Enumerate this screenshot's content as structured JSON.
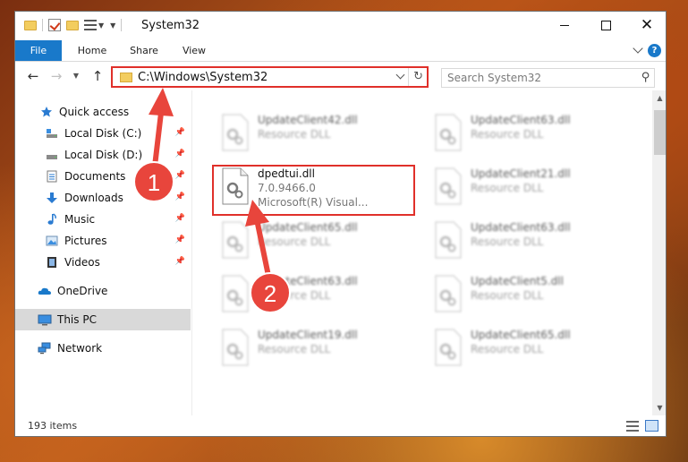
{
  "window": {
    "title": "System32",
    "controls": {
      "minimize": "minimize",
      "maximize": "maximize",
      "close": "✕"
    }
  },
  "ribbon": {
    "tabs": [
      "File",
      "Home",
      "Share",
      "View"
    ],
    "help": "?"
  },
  "nav": {
    "address": "C:\\Windows\\System32",
    "search_placeholder": "Search System32"
  },
  "sidebar": {
    "items": [
      {
        "label": "Quick access",
        "icon": "star-icon",
        "pinned": false
      },
      {
        "label": "Local Disk (C:)",
        "icon": "drive-icon",
        "pinned": true
      },
      {
        "label": "Local Disk (D:)",
        "icon": "drive-icon",
        "pinned": true
      },
      {
        "label": "Documents",
        "icon": "documents-icon",
        "pinned": true
      },
      {
        "label": "Downloads",
        "icon": "downloads-icon",
        "pinned": true
      },
      {
        "label": "Music",
        "icon": "music-icon",
        "pinned": true
      },
      {
        "label": "Pictures",
        "icon": "pictures-icon",
        "pinned": true
      },
      {
        "label": "Videos",
        "icon": "videos-icon",
        "pinned": true
      },
      {
        "label": "OneDrive",
        "icon": "onedrive-icon",
        "pinned": false
      },
      {
        "label": "This PC",
        "icon": "this-pc-icon",
        "pinned": false,
        "selected": true
      },
      {
        "label": "Network",
        "icon": "network-icon",
        "pinned": false
      }
    ]
  },
  "files": [
    {
      "name": "UpdateClient42.dll",
      "type": "Resource DLL",
      "dimmed": true
    },
    {
      "name": "UpdateClient63.dll",
      "type": "Resource DLL",
      "dimmed": true
    },
    {
      "name": "dpedtui.dll",
      "version": "7.0.9466.0",
      "type": "Microsoft(R) Visual...",
      "dimmed": false,
      "highlighted": true
    },
    {
      "name": "UpdateClient21.dll",
      "type": "Resource DLL",
      "dimmed": true
    },
    {
      "name": "UpdateClient65.dll",
      "type": "Resource DLL",
      "dimmed": true
    },
    {
      "name": "UpdateClient63.dll",
      "type": "Resource DLL",
      "dimmed": true
    },
    {
      "name": "UpdateClient63.dll",
      "type": "Resource DLL",
      "dimmed": true
    },
    {
      "name": "UpdateClient5.dll",
      "type": "Resource DLL",
      "dimmed": true
    },
    {
      "name": "UpdateClient19.dll",
      "type": "Resource DLL",
      "dimmed": true
    },
    {
      "name": "UpdateClient65.dll",
      "type": "Resource DLL",
      "dimmed": true
    }
  ],
  "status": {
    "item_count": "193 items"
  },
  "annotations": {
    "step1": "1",
    "step2": "2"
  },
  "colors": {
    "accent": "#1979ca",
    "highlight": "#e0302a",
    "arrow": "#e8453c",
    "selected_bg": "#d9d9d9"
  }
}
